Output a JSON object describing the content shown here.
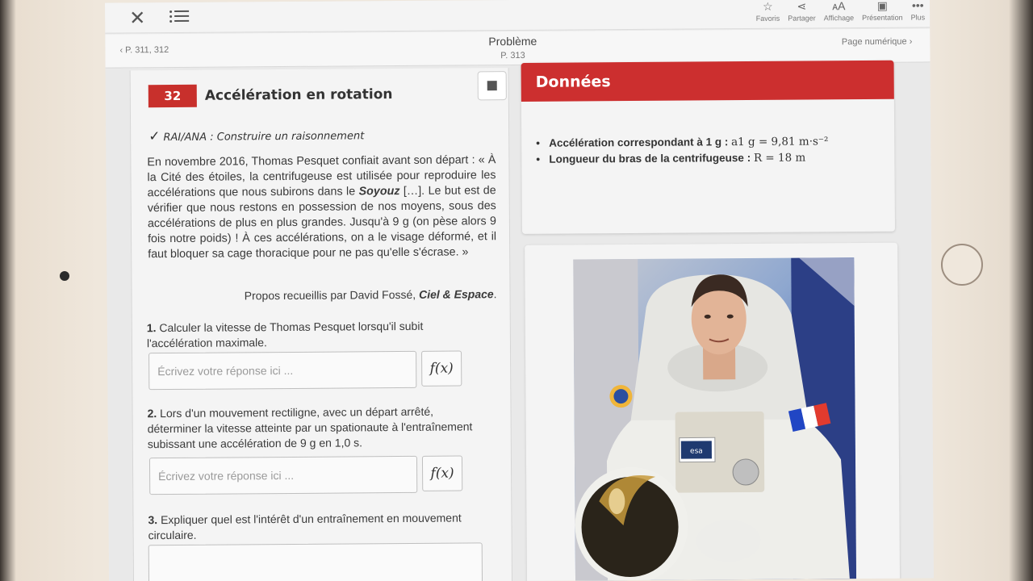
{
  "toolbar": {
    "actions": [
      {
        "label": "Favoris",
        "icon": "star-icon"
      },
      {
        "label": "Partager",
        "icon": "share-icon"
      },
      {
        "label": "Affichage",
        "icon": "text-size-icon"
      },
      {
        "label": "Présentation",
        "icon": "presentation-icon"
      },
      {
        "label": "Plus",
        "icon": "more-icon"
      }
    ]
  },
  "nav": {
    "prev": "P. 311, 312",
    "title": "Problème",
    "page": "P. 313",
    "next": "Page numérique"
  },
  "exercise": {
    "number": "32",
    "title": "Accélération en rotation",
    "skill": "RAI/ANA : Construire un raisonnement",
    "intro_before": "En novembre 2016, Thomas Pesquet confiait avant son départ : « À la Cité des étoiles, la centrifugeuse est utilisée pour reproduire les accélérations que nous subirons dans le ",
    "intro_vehicle": "Soyouz",
    "intro_after": " […]. Le but est de vérifier que nous restons en possession de nos moyens, sous des accélérations de plus en plus grandes. Jusqu'à 9 g (on pèse alors 9 fois notre poids) ! À ces accélérations, on a le visage déformé, et il faut bloquer sa cage thoracique pour ne pas qu'elle s'écrase. »",
    "source_prefix": "Propos recueillis par David Fossé, ",
    "source_mag": "Ciel & Espace",
    "source_suffix": ".",
    "questions": [
      {
        "num": "1.",
        "text": "Calculer la vitesse de Thomas Pesquet lorsqu'il subit l'accélération maximale."
      },
      {
        "num": "2.",
        "text": "Lors d'un mouvement rectiligne, avec un départ arrêté, déterminer la vitesse atteinte par un spationaute à l'entraînement subissant une accélération de 9 g en 1,0 s."
      },
      {
        "num": "3.",
        "text": "Expliquer quel est l'intérêt d'un entraînement en mouvement circulaire."
      }
    ],
    "answer_placeholder": "Écrivez votre réponse ici ...",
    "fx_label": "f(x)"
  },
  "data_box": {
    "title": "Données",
    "items": [
      {
        "label": "Accélération correspondant à 1 g :",
        "value": "a1 g = 9,81 m·s⁻²"
      },
      {
        "label": "Longueur du bras de la centrifugeuse :",
        "value": "R = 18 m"
      }
    ]
  },
  "photo": {
    "badge": "esa"
  },
  "colors": {
    "accent_red": "#cc2f2f",
    "exercise_badge": "#c8302c"
  }
}
